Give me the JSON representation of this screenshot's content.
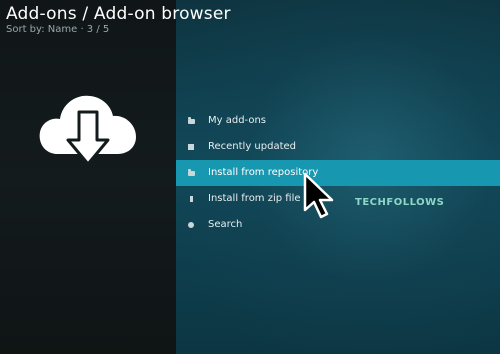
{
  "header": {
    "title": "Add-ons / Add-on browser",
    "subtitle": "Sort by: Name  · 3 / 5"
  },
  "main_icon": "cloud-download-icon",
  "menu": {
    "items": [
      {
        "label": "My add-ons",
        "icon": "folder-icon",
        "selected": false
      },
      {
        "label": "Recently updated",
        "icon": "square-icon",
        "selected": false
      },
      {
        "label": "Install from repository",
        "icon": "folder-icon",
        "selected": true
      },
      {
        "label": "Install from zip file",
        "icon": "zip-icon",
        "selected": false
      },
      {
        "label": "Search",
        "icon": "search-icon",
        "selected": false
      }
    ]
  },
  "watermark": "TECHFOLLOWS",
  "colors": {
    "selected_bg": "#1897b1",
    "right_panel": "#11495a",
    "left_panel": "#141b1d"
  }
}
